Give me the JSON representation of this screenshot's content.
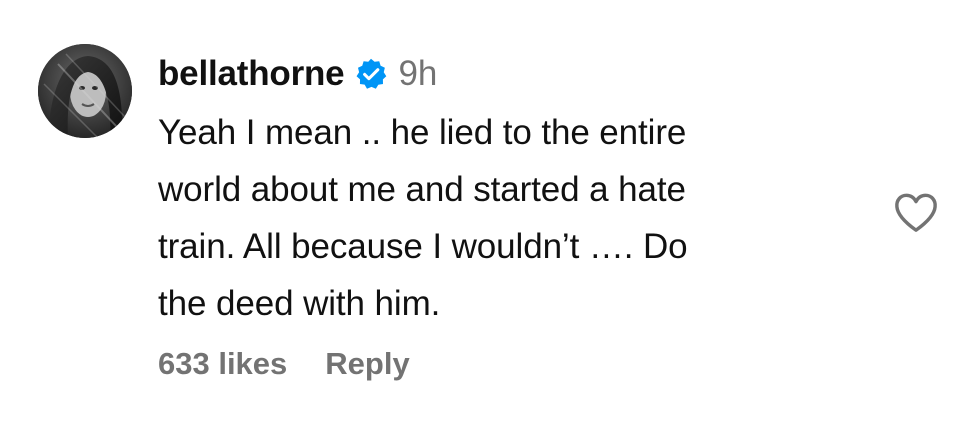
{
  "comment": {
    "username": "bellathorne",
    "verified": true,
    "timestamp": "9h",
    "text_lines": [
      "Yeah I mean .. he lied to the entire",
      "world about me and started a hate",
      "train. All because I wouldn’t …. Do",
      "the deed with him."
    ],
    "likes_label": "633 likes",
    "reply_label": "Reply"
  },
  "icons": {
    "avatar": "profile-photo",
    "verified": "verified-badge-icon",
    "like": "heart-outline-icon"
  },
  "colors": {
    "text": "#111111",
    "secondary_text": "#737373",
    "verified_blue": "#0095F6",
    "background": "#ffffff"
  }
}
